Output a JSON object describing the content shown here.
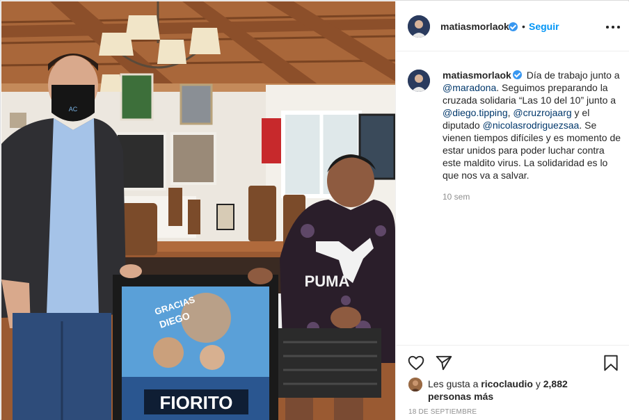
{
  "post": {
    "username": "matiasmorlaok",
    "follow_label": "Seguir",
    "dot": "•",
    "caption": {
      "text_1": " Día de trabajo junto a ",
      "mention_1": "@maradona",
      "text_2": ". Seguimos preparando la cruzada solidaria “Las 10 del 10” junto a ",
      "mention_2": "@diego.tipping",
      "text_3": ", ",
      "mention_3": "@cruzrojaarg",
      "text_4": " y el diputado ",
      "mention_4": "@nicolasrodriguezsaa",
      "text_5": ". Se vienen tiempos difíciles y es momento de estar unidos para poder luchar contra este maldito virus. La solidaridad es lo que nos va a salvar."
    },
    "time_ago": "10 sem",
    "likes": {
      "prefix": "Les gusta a ",
      "liker": "ricoclaudio",
      "middle": " y ",
      "others": "2,882 personas más"
    },
    "date": "18 DE SEPTIEMBRE"
  },
  "photo": {
    "poster_line_1": "GRACIAS",
    "poster_line_2": "DIEGO",
    "poster_footer": "FIORITO",
    "mask_text": "AC",
    "hoodie_brand": "PUMA"
  },
  "icons": {
    "verified": "verified-badge",
    "more": "more-options",
    "like": "heart",
    "share": "paper-plane",
    "save": "bookmark"
  },
  "colors": {
    "accent": "#0095f6",
    "verified": "#3897f0",
    "mention": "#00376b",
    "muted": "#8e8e8e"
  }
}
